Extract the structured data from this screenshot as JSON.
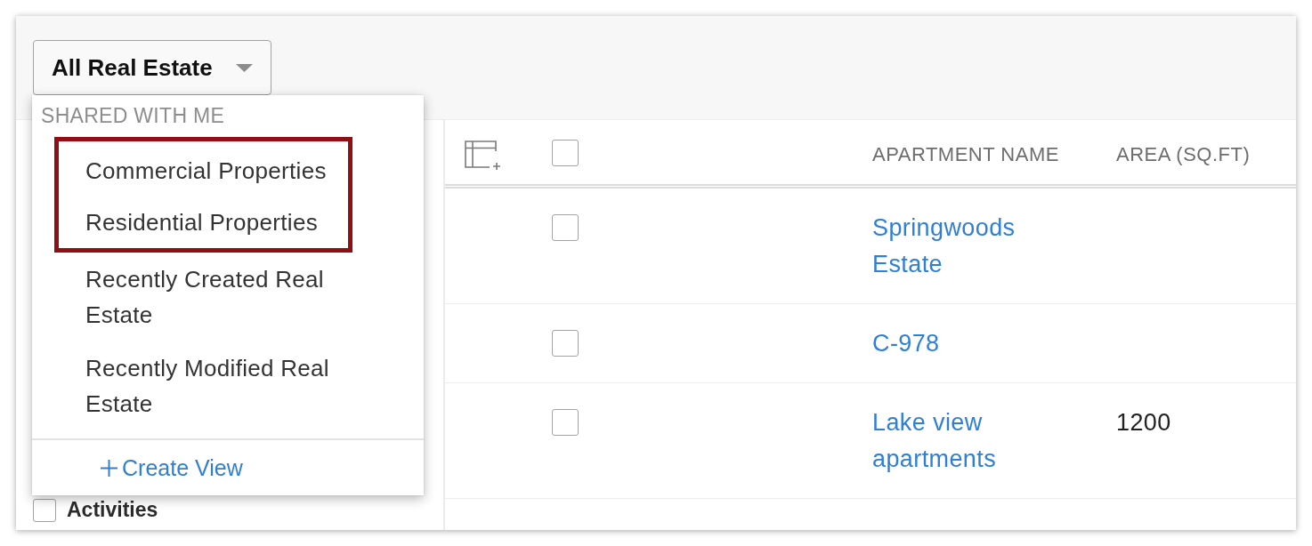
{
  "view_selector": {
    "label": "All Real Estate",
    "expanded": true
  },
  "view_menu": {
    "section_title": "SHARED WITH ME",
    "items": [
      {
        "label": "Commercial Properties",
        "highlighted": true
      },
      {
        "label": "Residential Properties",
        "highlighted": true
      },
      {
        "label": "Recently Created Real Estate",
        "highlighted": false
      },
      {
        "label": "Recently Modified Real Estate",
        "highlighted": false
      }
    ],
    "create_view": "Create View"
  },
  "sidebar": {
    "items": [
      {
        "label": "Activities",
        "checked": false
      }
    ]
  },
  "table": {
    "select_all_checked": false,
    "columns": [
      "APARTMENT NAME",
      "AREA (SQ.FT)"
    ],
    "rows": [
      {
        "checked": false,
        "apartment_name": "Springwoods Estate"
      },
      {
        "checked": false,
        "apartment_name": "C-978"
      },
      {
        "checked": false,
        "apartment_name": "Lake view apartments",
        "area": "1200"
      }
    ]
  }
}
